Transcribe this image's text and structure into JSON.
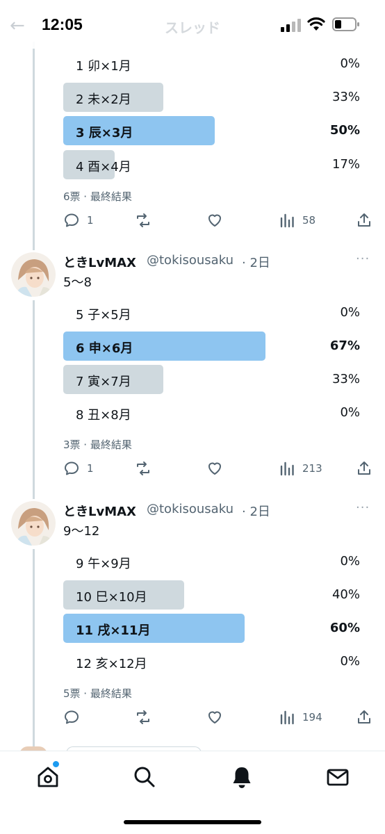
{
  "status_bar": {
    "time": "12:05"
  },
  "header": {
    "back_glyph": "←",
    "title": "スレッド"
  },
  "tweets": [
    {
      "poll": [
        {
          "label": "1 卯×1月",
          "pct": "0%",
          "fraction": 0.0,
          "winner": false
        },
        {
          "label": "2 未×2月",
          "pct": "33%",
          "fraction": 0.33,
          "winner": false
        },
        {
          "label": "3 辰×3月",
          "pct": "50%",
          "fraction": 0.5,
          "winner": true
        },
        {
          "label": "4 酉×4月",
          "pct": "17%",
          "fraction": 0.17,
          "winner": false
        }
      ],
      "meta": "6票 · 最終結果",
      "actions": {
        "replies": "1",
        "retweets": "",
        "likes": "",
        "views": "58"
      }
    },
    {
      "author": {
        "name": "ときLvMAX",
        "handle": "@tokisousaku",
        "time": "· 2日"
      },
      "text": "5〜8",
      "poll": [
        {
          "label": "5 子×5月",
          "pct": "0%",
          "fraction": 0.0,
          "winner": false
        },
        {
          "label": "6 申×6月",
          "pct": "67%",
          "fraction": 0.67,
          "winner": true
        },
        {
          "label": "7 寅×7月",
          "pct": "33%",
          "fraction": 0.33,
          "winner": false
        },
        {
          "label": "8 丑×8月",
          "pct": "0%",
          "fraction": 0.0,
          "winner": false
        }
      ],
      "meta": "3票 · 最終結果",
      "actions": {
        "replies": "1",
        "retweets": "",
        "likes": "",
        "views": "213"
      }
    },
    {
      "author": {
        "name": "ときLvMAX",
        "handle": "@tokisousaku",
        "time": "· 2日"
      },
      "text": "9〜12",
      "poll": [
        {
          "label": "9 午×9月",
          "pct": "0%",
          "fraction": 0.0,
          "winner": false
        },
        {
          "label": "10 巳×10月",
          "pct": "40%",
          "fraction": 0.4,
          "winner": false
        },
        {
          "label": "11 戌×11月",
          "pct": "60%",
          "fraction": 0.6,
          "winner": true
        },
        {
          "label": "12 亥×12月",
          "pct": "0%",
          "fraction": 0.0,
          "winner": false
        }
      ],
      "meta": "5票 · 最終結果",
      "actions": {
        "replies": "",
        "retweets": "",
        "likes": "",
        "views": "194"
      }
    }
  ],
  "more_glyph": "···",
  "nav": {
    "items": [
      "home-icon",
      "search-icon",
      "notifications-icon",
      "messages-icon"
    ],
    "home_has_badge": true
  },
  "colors": {
    "poll_winner": "#8ec5f0",
    "poll_other": "#cfd9de",
    "accent": "#1d9bf0",
    "muted": "#536471"
  }
}
